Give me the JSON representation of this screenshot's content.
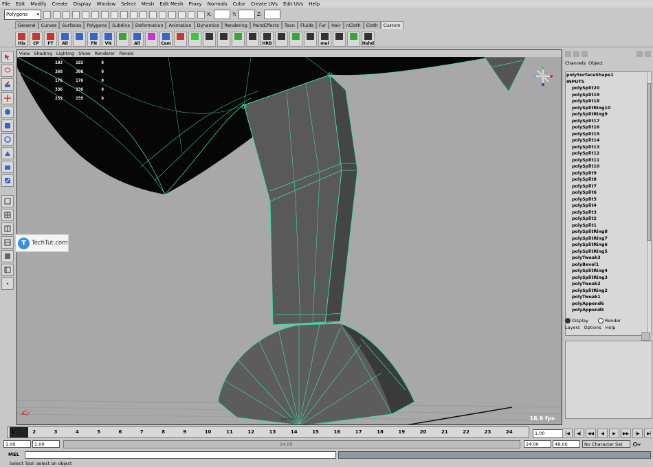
{
  "menubar": [
    "File",
    "Edit",
    "Modify",
    "Create",
    "Display",
    "Window",
    "Select",
    "Mesh",
    "Edit Mesh",
    "Proxy",
    "Normals",
    "Color",
    "Create UVs",
    "Edit UVs",
    "Help"
  ],
  "status": {
    "mode": "Polygons",
    "x_label": "X:",
    "y_label": "Y:",
    "z_label": "Z:"
  },
  "shelf_tabs": [
    "General",
    "Curves",
    "Surfaces",
    "Polygons",
    "Subdivs",
    "Deformation",
    "Animation",
    "Dynamics",
    "Rendering",
    "PaintEffects",
    "Toon",
    "Fluids",
    "Fur",
    "Hair",
    "nCloth",
    "Cloth",
    "Custom"
  ],
  "shelf_active_tab": "Custom",
  "shelf_buttons": [
    "His",
    "CP",
    "FT",
    "All",
    "",
    "FN",
    "VN",
    "",
    "All",
    "",
    "Cam",
    "",
    "",
    "",
    "",
    "",
    "",
    "HRB",
    "",
    "",
    "",
    "mel",
    "",
    "",
    "Hshd"
  ],
  "viewport": {
    "menu": [
      "View",
      "Shading",
      "Lighting",
      "Show",
      "Renderer",
      "Panels"
    ],
    "hud": [
      [
        "103",
        "103",
        "0"
      ],
      [
        "360",
        "360",
        "0"
      ],
      [
        "176",
        "176",
        "0"
      ],
      [
        "336",
        "336",
        "0"
      ],
      [
        "259",
        "259",
        "0"
      ]
    ],
    "fps": "18.9 fps",
    "axis_x": "x",
    "axis_z": "z",
    "camera_label": "persp"
  },
  "channel_box": {
    "tabs": [
      "Channels",
      "Object"
    ],
    "title": "polySurfaceShape1",
    "header": "INPUTS",
    "items": [
      "polySplit20",
      "polySplit19",
      "polySplit18",
      "polySplitRing10",
      "polySplitRing9",
      "polySplit17",
      "polySplit16",
      "polySplit15",
      "polySplit14",
      "polySplit13",
      "polySplit12",
      "polySplit11",
      "polySplit10",
      "polySplit9",
      "polySplit8",
      "polySplit7",
      "polySplit6",
      "polySplit5",
      "polySplit4",
      "polySplit3",
      "polySplit2",
      "polySplit1",
      "polySplitRing8",
      "polySplitRing7",
      "polySplitRing6",
      "polySplitRing5",
      "polyTweak3",
      "polyBevel1",
      "polySplitRing4",
      "polySplitRing3",
      "polyTweak2",
      "polySplitRing2",
      "polyTweak1",
      "polyAppend6",
      "polyAppend5"
    ]
  },
  "layers": {
    "radio_display": "Display",
    "radio_render": "Render",
    "menu": [
      "Layers",
      "Options",
      "Help"
    ]
  },
  "timeline": {
    "ticks": [
      "1",
      "2",
      "3",
      "4",
      "5",
      "6",
      "7",
      "8",
      "9",
      "10",
      "11",
      "12",
      "13",
      "14",
      "15",
      "16",
      "17",
      "18",
      "19",
      "20",
      "21",
      "22",
      "23",
      "24"
    ],
    "current": "1.00"
  },
  "range": {
    "start": "1.00",
    "inner_start": "1.00",
    "bar_label": "24.00",
    "inner_end": "24.00",
    "end": "48.00",
    "char_set": "No Character Set"
  },
  "cmd": {
    "label": "MEL"
  },
  "help_line": "Select Tool: select an object",
  "watermark": "TechTut.com",
  "colors": {
    "viewport_bg": "#a8a8a8",
    "mesh_face": "#555555",
    "mesh_wire": "#3fd9a0",
    "top_face": "#000000"
  }
}
